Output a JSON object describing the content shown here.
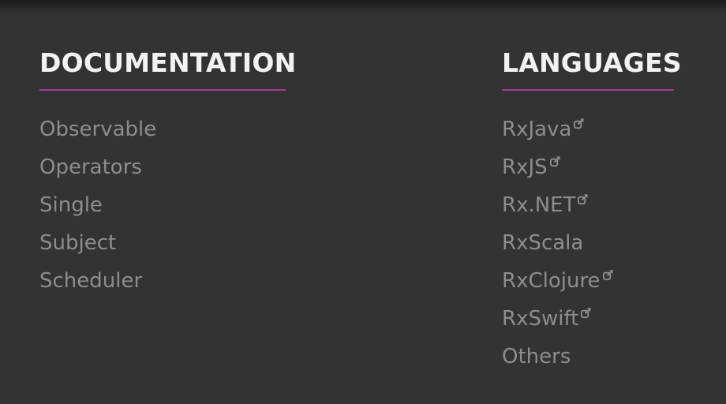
{
  "footer": {
    "documentation": {
      "heading": "DOCUMENTATION",
      "links": [
        {
          "label": "Observable"
        },
        {
          "label": "Operators"
        },
        {
          "label": "Single"
        },
        {
          "label": "Subject"
        },
        {
          "label": "Scheduler"
        }
      ]
    },
    "languages": {
      "heading": "LANGUAGES",
      "links": [
        {
          "label": "RxJava",
          "external": true
        },
        {
          "label": "RxJS",
          "external": true
        },
        {
          "label": "Rx.NET",
          "external": true
        },
        {
          "label": "RxScala",
          "external": false
        },
        {
          "label": "RxClojure",
          "external": true
        },
        {
          "label": "RxSwift",
          "external": true
        },
        {
          "label": "Others",
          "external": false
        }
      ]
    }
  },
  "colors": {
    "background": "#333333",
    "heading": "#f2f2f2",
    "accent_rule": "#a23b97",
    "link": "#8d8d8d"
  },
  "icons": {
    "external_link": "external-link-icon"
  }
}
